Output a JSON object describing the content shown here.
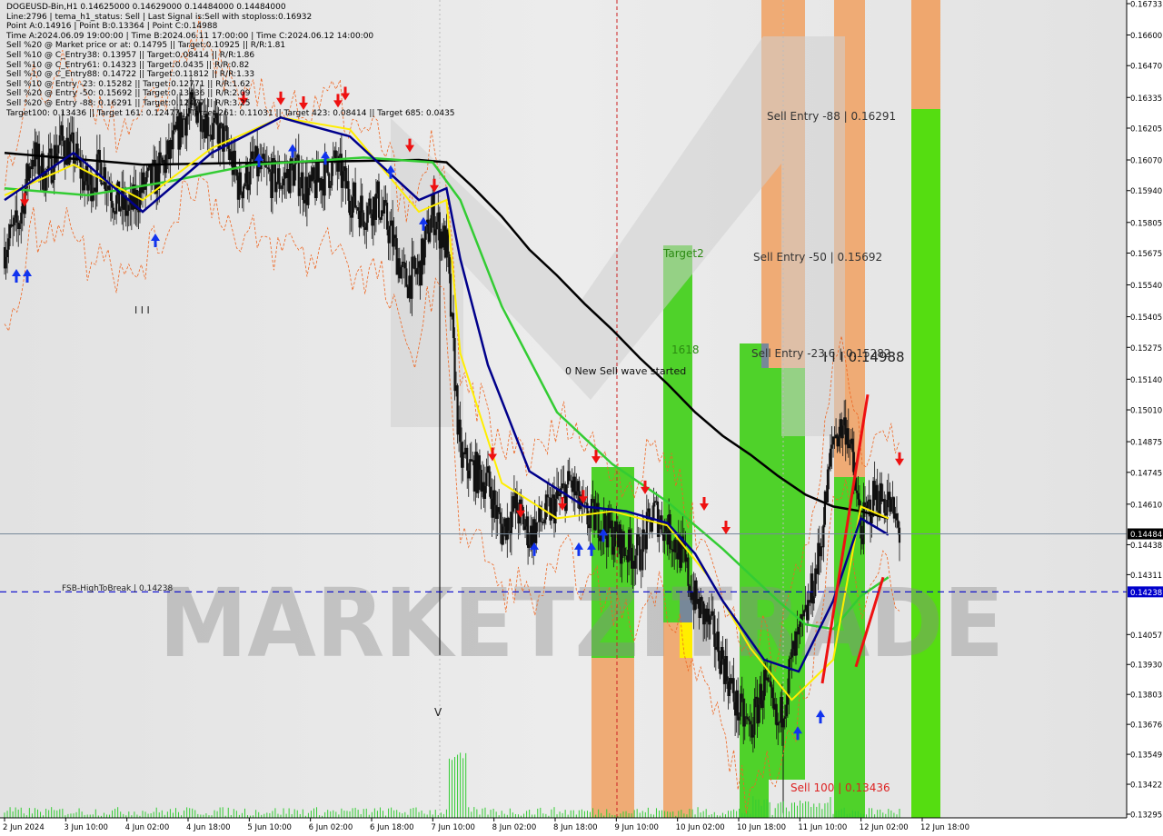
{
  "info_lines": [
    "DOGEUSD-Bin,H1  0.14625000 0.14629000 0.14484000 0.14484000",
    "Line:2796 | tema_h1_status: Sell | Last Signal is:Sell with stoploss:0.16932",
    "Point A:0.14916 | Point B:0.13364 | Point C:0.14988",
    "Time A:2024.06.09 19:00:00 | Time B:2024.06.11 17:00:00 | Time C:2024.06.12 14:00:00",
    "Sell %20 @ Market price or at: 0.14795 || Target:0.10925 || R/R:1.81",
    "Sell %10 @ C_Entry38: 0.13957 || Target:0.08414 || R/R:1.86",
    "Sell %10 @ C_Entry61: 0.14323 || Target:0.0435 || R/R:0.82",
    "Sell %10 @ C_Entry88: 0.14722 || Target:0.11812 || R/R:1.33",
    "Sell %10 @ Entry -23: 0.15282 || Target:0.12771 || R/R:1.62",
    "Sell %20 @ Entry -50: 0.15692 || Target:0.13436 || R/R:2.09",
    "Sell %20 @ Entry -88: 0.16291 || Target:0.12477 || R/R:3.25",
    "Target100: 0.13436 || Target 161: 0.12477 || Target 261: 0.11031 || Target 423: 0.08414 || Target 685: 0.0435"
  ],
  "annotations": {
    "sell_entry_88": "Sell Entry -88 | 0.16291",
    "sell_entry_50": "Sell Entry -50 | 0.15692",
    "sell_entry_23": "Sell Entry -23.6 | 0.15282",
    "target2": "Target2",
    "t1618": "1618",
    "wave": "0 New Sell wave started",
    "pointc": "I I I 0.14988",
    "sell100": "Sell 100 | 0.13436",
    "fsb": "FSB-HighToBreak | 0.14238",
    "v_mark": "V",
    "bars_mark": "I I I"
  },
  "watermark": "MARKETZITRADE",
  "colors": {
    "green": "#4fd22a",
    "orange": "#f0a060",
    "yellow": "#ffee00",
    "ema200": "#000000",
    "tema_green": "#33cc33",
    "tema_blue": "#00008b",
    "tema_yellow": "#ffee00",
    "current_price_line": "#778899",
    "fsb_line": "#0000cc"
  },
  "chart_data": {
    "type": "candlestick",
    "symbol": "DOGEUSD-Bin",
    "timeframe": "H1",
    "ylim": [
      0.13295,
      0.16733
    ],
    "current_price": 0.14484,
    "fsb_level": 0.14238,
    "y_ticks": [
      "0.16733",
      "0.16600",
      "0.16470",
      "0.16335",
      "0.16205",
      "0.16070",
      "0.15940",
      "0.15805",
      "0.15675",
      "0.15540",
      "0.15405",
      "0.15275",
      "0.15140",
      "0.15010",
      "0.14875",
      "0.14745",
      "0.14610",
      "0.14484",
      "0.14438",
      "0.14311",
      "0.14238",
      "0.14057",
      "0.13930",
      "0.13803",
      "0.13676",
      "0.13549",
      "0.13422",
      "0.13295"
    ],
    "x_ticks": [
      "2 Jun 2024",
      "3 Jun 10:00",
      "4 Jun 02:00",
      "4 Jun 18:00",
      "5 Jun 10:00",
      "6 Jun 02:00",
      "6 Jun 18:00",
      "7 Jun 10:00",
      "8 Jun 02:00",
      "8 Jun 18:00",
      "9 Jun 10:00",
      "10 Jun 02:00",
      "10 Jun 18:00",
      "11 Jun 10:00",
      "12 Jun 02:00",
      "12 Jun 18:00"
    ],
    "close_path": [
      [
        0,
        0.157
      ],
      [
        10,
        0.158
      ],
      [
        20,
        0.161
      ],
      [
        30,
        0.16
      ],
      [
        40,
        0.1615
      ],
      [
        50,
        0.161
      ],
      [
        60,
        0.1595
      ],
      [
        70,
        0.1605
      ],
      [
        80,
        0.159
      ],
      [
        90,
        0.1585
      ],
      [
        100,
        0.1595
      ],
      [
        110,
        0.16
      ],
      [
        120,
        0.161
      ],
      [
        130,
        0.1625
      ],
      [
        140,
        0.163
      ],
      [
        150,
        0.162
      ],
      [
        160,
        0.1615
      ],
      [
        170,
        0.1595
      ],
      [
        180,
        0.1605
      ],
      [
        190,
        0.16
      ],
      [
        200,
        0.1598
      ],
      [
        210,
        0.1603
      ],
      [
        220,
        0.1593
      ],
      [
        230,
        0.16
      ],
      [
        240,
        0.1605
      ],
      [
        250,
        0.1592
      ],
      [
        260,
        0.1585
      ],
      [
        270,
        0.159
      ],
      [
        280,
        0.1575
      ],
      [
        290,
        0.1555
      ],
      [
        300,
        0.156
      ],
      [
        310,
        0.1585
      ],
      [
        320,
        0.157
      ],
      [
        330,
        0.148
      ],
      [
        340,
        0.1475
      ],
      [
        350,
        0.147
      ],
      [
        360,
        0.145
      ],
      [
        370,
        0.146
      ],
      [
        380,
        0.1448
      ],
      [
        390,
        0.1455
      ],
      [
        400,
        0.1462
      ],
      [
        410,
        0.147
      ],
      [
        420,
        0.1455
      ],
      [
        430,
        0.1455
      ],
      [
        440,
        0.1448
      ],
      [
        450,
        0.1442
      ],
      [
        460,
        0.144
      ],
      [
        470,
        0.1458
      ],
      [
        480,
        0.145
      ],
      [
        490,
        0.144
      ],
      [
        500,
        0.142
      ],
      [
        510,
        0.141
      ],
      [
        520,
        0.1395
      ],
      [
        530,
        0.1375
      ],
      [
        540,
        0.1365
      ],
      [
        550,
        0.1385
      ],
      [
        560,
        0.1365
      ],
      [
        570,
        0.1395
      ],
      [
        580,
        0.1412
      ],
      [
        590,
        0.144
      ],
      [
        600,
        0.149
      ],
      [
        610,
        0.1495
      ],
      [
        620,
        0.145
      ],
      [
        630,
        0.1465
      ],
      [
        640,
        0.1462
      ],
      [
        648,
        0.14484
      ]
    ],
    "ema200_path": [
      [
        0,
        0.161
      ],
      [
        100,
        0.1605
      ],
      [
        200,
        0.1606
      ],
      [
        300,
        0.1607
      ],
      [
        320,
        0.1606
      ],
      [
        340,
        0.1595
      ],
      [
        360,
        0.1583
      ],
      [
        380,
        0.1569
      ],
      [
        400,
        0.1558
      ],
      [
        420,
        0.1546
      ],
      [
        440,
        0.1535
      ],
      [
        460,
        0.1523
      ],
      [
        480,
        0.1512
      ],
      [
        500,
        0.15
      ],
      [
        520,
        0.149
      ],
      [
        540,
        0.1482
      ],
      [
        560,
        0.1473
      ],
      [
        580,
        0.1465
      ],
      [
        600,
        0.146
      ],
      [
        620,
        0.1458
      ],
      [
        640,
        0.1455
      ]
    ],
    "tema_green_path": [
      [
        0,
        0.1595
      ],
      [
        60,
        0.1592
      ],
      [
        120,
        0.1598
      ],
      [
        180,
        0.1605
      ],
      [
        260,
        0.1608
      ],
      [
        310,
        0.1606
      ],
      [
        330,
        0.159
      ],
      [
        360,
        0.1545
      ],
      [
        400,
        0.15
      ],
      [
        440,
        0.1478
      ],
      [
        480,
        0.1462
      ],
      [
        520,
        0.1442
      ],
      [
        560,
        0.142
      ],
      [
        580,
        0.141
      ],
      [
        600,
        0.1408
      ],
      [
        620,
        0.1422
      ],
      [
        640,
        0.143
      ]
    ],
    "tema_blue_path": [
      [
        0,
        0.159
      ],
      [
        50,
        0.161
      ],
      [
        100,
        0.1585
      ],
      [
        150,
        0.161
      ],
      [
        200,
        0.1625
      ],
      [
        250,
        0.1617
      ],
      [
        300,
        0.159
      ],
      [
        320,
        0.1595
      ],
      [
        330,
        0.1565
      ],
      [
        350,
        0.152
      ],
      [
        380,
        0.1475
      ],
      [
        420,
        0.146
      ],
      [
        450,
        0.1458
      ],
      [
        480,
        0.1453
      ],
      [
        500,
        0.144
      ],
      [
        520,
        0.142
      ],
      [
        550,
        0.1395
      ],
      [
        575,
        0.139
      ],
      [
        600,
        0.142
      ],
      [
        620,
        0.1455
      ],
      [
        640,
        0.1448
      ]
    ],
    "tema_yellow_path": [
      [
        0,
        0.1592
      ],
      [
        50,
        0.1605
      ],
      [
        100,
        0.159
      ],
      [
        150,
        0.1612
      ],
      [
        200,
        0.1625
      ],
      [
        250,
        0.162
      ],
      [
        300,
        0.1585
      ],
      [
        320,
        0.159
      ],
      [
        330,
        0.1525
      ],
      [
        360,
        0.147
      ],
      [
        400,
        0.1455
      ],
      [
        440,
        0.1458
      ],
      [
        480,
        0.1452
      ],
      [
        510,
        0.143
      ],
      [
        540,
        0.14
      ],
      [
        570,
        0.1378
      ],
      [
        600,
        0.1395
      ],
      [
        620,
        0.146
      ],
      [
        640,
        0.1455
      ]
    ]
  }
}
